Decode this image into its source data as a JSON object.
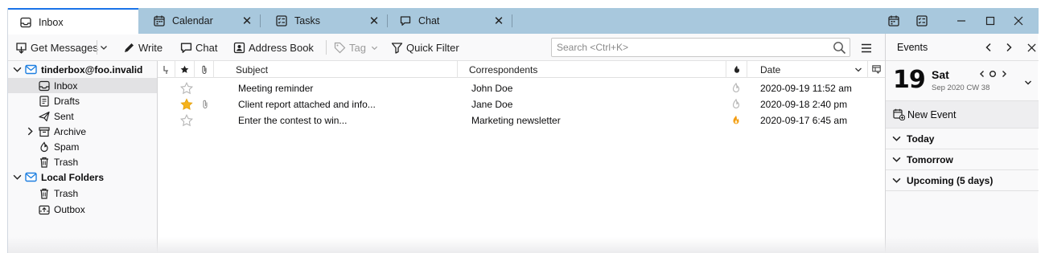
{
  "tabs": [
    {
      "label": "Inbox",
      "icon": "inbox-icon"
    },
    {
      "label": "Calendar",
      "icon": "calendar-icon"
    },
    {
      "label": "Tasks",
      "icon": "tasks-icon"
    },
    {
      "label": "Chat",
      "icon": "chat-icon"
    }
  ],
  "toolbar": {
    "get_messages": "Get Messages",
    "write": "Write",
    "chat": "Chat",
    "address_book": "Address Book",
    "tag": "Tag",
    "quick_filter": "Quick Filter",
    "search_placeholder": "Search <Ctrl+K>"
  },
  "folders": [
    {
      "label": "tinderbox@foo.invalid",
      "icon": "account-mail-icon",
      "bold": true,
      "twisty": "open"
    },
    {
      "label": "Inbox",
      "icon": "inbox-icon",
      "selected": true
    },
    {
      "label": "Drafts",
      "icon": "drafts-icon"
    },
    {
      "label": "Sent",
      "icon": "sent-icon"
    },
    {
      "label": "Archive",
      "icon": "archive-icon",
      "twisty": "closed"
    },
    {
      "label": "Spam",
      "icon": "spam-icon"
    },
    {
      "label": "Trash",
      "icon": "trash-icon"
    },
    {
      "label": "Local Folders",
      "icon": "local-folders-icon",
      "bold": true,
      "twisty": "open"
    },
    {
      "label": "Trash",
      "icon": "trash-icon"
    },
    {
      "label": "Outbox",
      "icon": "outbox-icon"
    }
  ],
  "columns": {
    "subject": "Subject",
    "correspondents": "Correspondents",
    "date": "Date"
  },
  "messages": [
    {
      "starred": false,
      "attachment": false,
      "subject": "Meeting reminder",
      "correspondent": "John Doe",
      "junk": false,
      "date": "2020-09-19 11:52 am"
    },
    {
      "starred": true,
      "attachment": true,
      "subject": "Client report attached and info...",
      "correspondent": "Jane Doe",
      "junk": false,
      "date": "2020-09-18 2:40 pm"
    },
    {
      "starred": false,
      "attachment": false,
      "subject": "Enter the contest to win...",
      "correspondent": "Marketing newsletter",
      "junk": true,
      "date": "2020-09-17 6:45 am"
    }
  ],
  "events": {
    "title": "Events",
    "day_number": "19",
    "day_name": "Sat",
    "month_week": "Sep 2020 CW 38",
    "new_event": "New Event",
    "sections": [
      "Today",
      "Tomorrow",
      "Upcoming (5 days)"
    ]
  },
  "colors": {
    "tabbar": "#a8c8dd",
    "active_tab_accent": "#1a73e8",
    "star": "#f5b21b",
    "junk": "#f39c12",
    "account_icon": "#1e7fe0"
  }
}
